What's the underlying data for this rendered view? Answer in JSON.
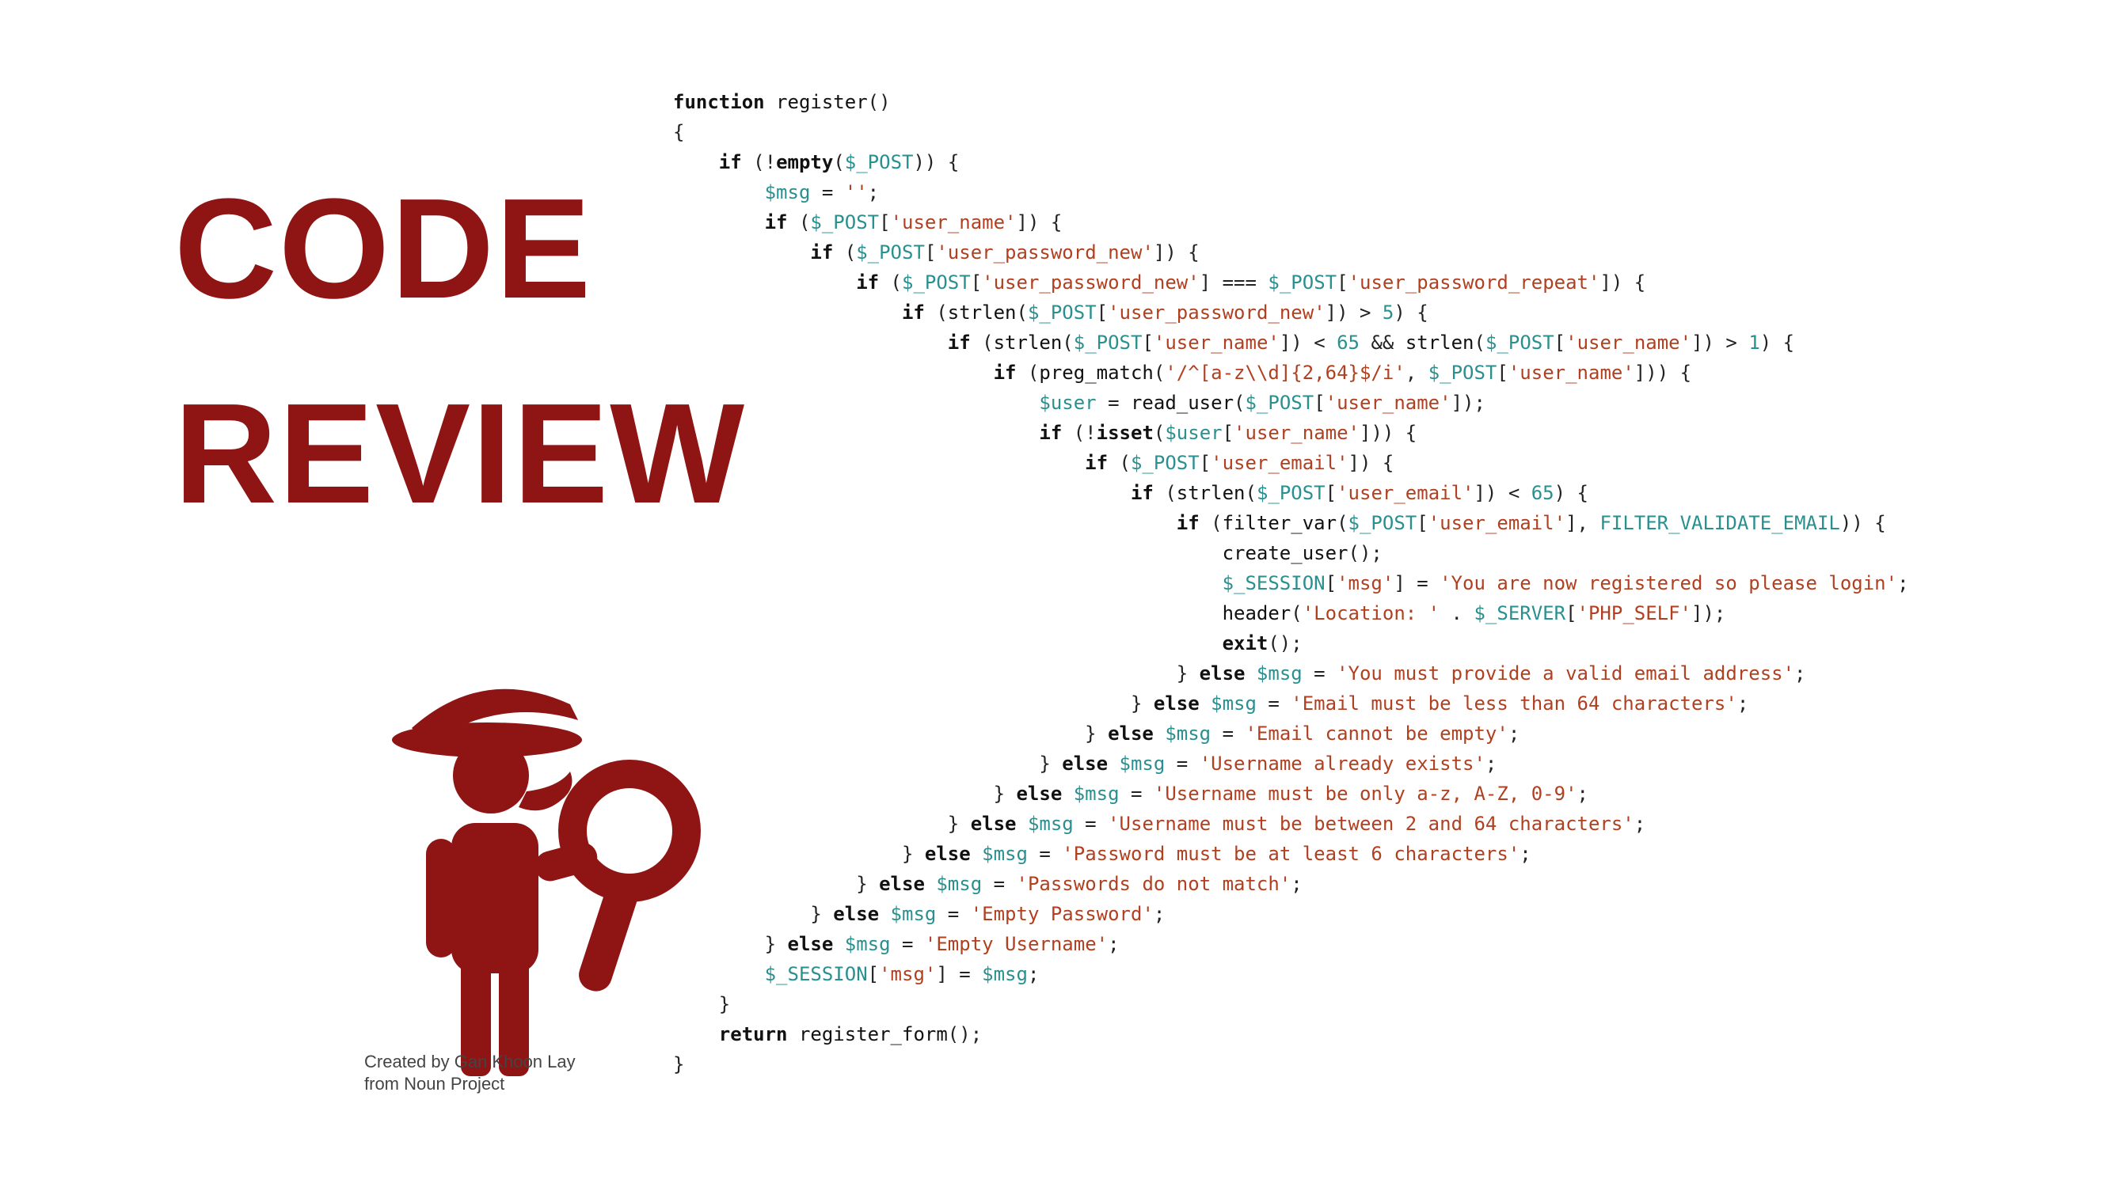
{
  "title": {
    "line1": "CODE",
    "line2": "REVIEW"
  },
  "attribution": {
    "line1": "Created by Gan Khoon Lay",
    "line2": "from Noun Project"
  },
  "colors": {
    "accent": "#8f1515",
    "keyword": "#111111",
    "variable": "#2a8f8f",
    "string": "#b04020",
    "background": "#ffffff"
  },
  "code": {
    "language": "php",
    "lines": [
      {
        "indent": 0,
        "tokens": [
          {
            "t": "k",
            "v": "function"
          },
          {
            "t": "p",
            "v": " "
          },
          {
            "t": "fn",
            "v": "register"
          },
          {
            "t": "p",
            "v": "()"
          }
        ]
      },
      {
        "indent": 0,
        "tokens": [
          {
            "t": "p",
            "v": "{"
          }
        ]
      },
      {
        "indent": 1,
        "tokens": [
          {
            "t": "k",
            "v": "if"
          },
          {
            "t": "p",
            "v": " (!"
          },
          {
            "t": "k",
            "v": "empty"
          },
          {
            "t": "p",
            "v": "("
          },
          {
            "t": "v",
            "v": "$_POST"
          },
          {
            "t": "p",
            "v": ")) {"
          }
        ]
      },
      {
        "indent": 2,
        "tokens": [
          {
            "t": "v",
            "v": "$msg"
          },
          {
            "t": "p",
            "v": " = "
          },
          {
            "t": "s",
            "v": "''"
          },
          {
            "t": "p",
            "v": ";"
          }
        ]
      },
      {
        "indent": 2,
        "tokens": [
          {
            "t": "k",
            "v": "if"
          },
          {
            "t": "p",
            "v": " ("
          },
          {
            "t": "v",
            "v": "$_POST"
          },
          {
            "t": "p",
            "v": "["
          },
          {
            "t": "s",
            "v": "'user_name'"
          },
          {
            "t": "p",
            "v": "]) {"
          }
        ]
      },
      {
        "indent": 3,
        "tokens": [
          {
            "t": "k",
            "v": "if"
          },
          {
            "t": "p",
            "v": " ("
          },
          {
            "t": "v",
            "v": "$_POST"
          },
          {
            "t": "p",
            "v": "["
          },
          {
            "t": "s",
            "v": "'user_password_new'"
          },
          {
            "t": "p",
            "v": "]) {"
          }
        ]
      },
      {
        "indent": 4,
        "tokens": [
          {
            "t": "k",
            "v": "if"
          },
          {
            "t": "p",
            "v": " ("
          },
          {
            "t": "v",
            "v": "$_POST"
          },
          {
            "t": "p",
            "v": "["
          },
          {
            "t": "s",
            "v": "'user_password_new'"
          },
          {
            "t": "p",
            "v": "] === "
          },
          {
            "t": "v",
            "v": "$_POST"
          },
          {
            "t": "p",
            "v": "["
          },
          {
            "t": "s",
            "v": "'user_password_repeat'"
          },
          {
            "t": "p",
            "v": "]) {"
          }
        ]
      },
      {
        "indent": 5,
        "tokens": [
          {
            "t": "k",
            "v": "if"
          },
          {
            "t": "p",
            "v": " ("
          },
          {
            "t": "fn",
            "v": "strlen"
          },
          {
            "t": "p",
            "v": "("
          },
          {
            "t": "v",
            "v": "$_POST"
          },
          {
            "t": "p",
            "v": "["
          },
          {
            "t": "s",
            "v": "'user_password_new'"
          },
          {
            "t": "p",
            "v": "]) > "
          },
          {
            "t": "n",
            "v": "5"
          },
          {
            "t": "p",
            "v": ") {"
          }
        ]
      },
      {
        "indent": 6,
        "tokens": [
          {
            "t": "k",
            "v": "if"
          },
          {
            "t": "p",
            "v": " ("
          },
          {
            "t": "fn",
            "v": "strlen"
          },
          {
            "t": "p",
            "v": "("
          },
          {
            "t": "v",
            "v": "$_POST"
          },
          {
            "t": "p",
            "v": "["
          },
          {
            "t": "s",
            "v": "'user_name'"
          },
          {
            "t": "p",
            "v": "]) < "
          },
          {
            "t": "n",
            "v": "65"
          },
          {
            "t": "p",
            "v": " && "
          },
          {
            "t": "fn",
            "v": "strlen"
          },
          {
            "t": "p",
            "v": "("
          },
          {
            "t": "v",
            "v": "$_POST"
          },
          {
            "t": "p",
            "v": "["
          },
          {
            "t": "s",
            "v": "'user_name'"
          },
          {
            "t": "p",
            "v": "]) > "
          },
          {
            "t": "n",
            "v": "1"
          },
          {
            "t": "p",
            "v": ") {"
          }
        ]
      },
      {
        "indent": 7,
        "tokens": [
          {
            "t": "k",
            "v": "if"
          },
          {
            "t": "p",
            "v": " ("
          },
          {
            "t": "fn",
            "v": "preg_match"
          },
          {
            "t": "p",
            "v": "("
          },
          {
            "t": "s",
            "v": "'/^[a-z\\\\d]{2,64}$/i'"
          },
          {
            "t": "p",
            "v": ", "
          },
          {
            "t": "v",
            "v": "$_POST"
          },
          {
            "t": "p",
            "v": "["
          },
          {
            "t": "s",
            "v": "'user_name'"
          },
          {
            "t": "p",
            "v": "])) {"
          }
        ]
      },
      {
        "indent": 8,
        "tokens": [
          {
            "t": "v",
            "v": "$user"
          },
          {
            "t": "p",
            "v": " = "
          },
          {
            "t": "fn",
            "v": "read_user"
          },
          {
            "t": "p",
            "v": "("
          },
          {
            "t": "v",
            "v": "$_POST"
          },
          {
            "t": "p",
            "v": "["
          },
          {
            "t": "s",
            "v": "'user_name'"
          },
          {
            "t": "p",
            "v": "]);"
          }
        ]
      },
      {
        "indent": 8,
        "tokens": [
          {
            "t": "k",
            "v": "if"
          },
          {
            "t": "p",
            "v": " (!"
          },
          {
            "t": "k",
            "v": "isset"
          },
          {
            "t": "p",
            "v": "("
          },
          {
            "t": "v",
            "v": "$user"
          },
          {
            "t": "p",
            "v": "["
          },
          {
            "t": "s",
            "v": "'user_name'"
          },
          {
            "t": "p",
            "v": "])) {"
          }
        ]
      },
      {
        "indent": 9,
        "tokens": [
          {
            "t": "k",
            "v": "if"
          },
          {
            "t": "p",
            "v": " ("
          },
          {
            "t": "v",
            "v": "$_POST"
          },
          {
            "t": "p",
            "v": "["
          },
          {
            "t": "s",
            "v": "'user_email'"
          },
          {
            "t": "p",
            "v": "]) {"
          }
        ]
      },
      {
        "indent": 10,
        "tokens": [
          {
            "t": "k",
            "v": "if"
          },
          {
            "t": "p",
            "v": " ("
          },
          {
            "t": "fn",
            "v": "strlen"
          },
          {
            "t": "p",
            "v": "("
          },
          {
            "t": "v",
            "v": "$_POST"
          },
          {
            "t": "p",
            "v": "["
          },
          {
            "t": "s",
            "v": "'user_email'"
          },
          {
            "t": "p",
            "v": "]) < "
          },
          {
            "t": "n",
            "v": "65"
          },
          {
            "t": "p",
            "v": ") {"
          }
        ]
      },
      {
        "indent": 11,
        "tokens": [
          {
            "t": "k",
            "v": "if"
          },
          {
            "t": "p",
            "v": " ("
          },
          {
            "t": "fn",
            "v": "filter_var"
          },
          {
            "t": "p",
            "v": "("
          },
          {
            "t": "v",
            "v": "$_POST"
          },
          {
            "t": "p",
            "v": "["
          },
          {
            "t": "s",
            "v": "'user_email'"
          },
          {
            "t": "p",
            "v": "], "
          },
          {
            "t": "v",
            "v": "FILTER_VALIDATE_EMAIL"
          },
          {
            "t": "p",
            "v": ")) {"
          }
        ]
      },
      {
        "indent": 12,
        "tokens": [
          {
            "t": "fn",
            "v": "create_user"
          },
          {
            "t": "p",
            "v": "();"
          }
        ]
      },
      {
        "indent": 12,
        "tokens": [
          {
            "t": "v",
            "v": "$_SESSION"
          },
          {
            "t": "p",
            "v": "["
          },
          {
            "t": "s",
            "v": "'msg'"
          },
          {
            "t": "p",
            "v": "] = "
          },
          {
            "t": "s",
            "v": "'You are now registered so please login'"
          },
          {
            "t": "p",
            "v": ";"
          }
        ]
      },
      {
        "indent": 12,
        "tokens": [
          {
            "t": "fn",
            "v": "header"
          },
          {
            "t": "p",
            "v": "("
          },
          {
            "t": "s",
            "v": "'Location: '"
          },
          {
            "t": "p",
            "v": " . "
          },
          {
            "t": "v",
            "v": "$_SERVER"
          },
          {
            "t": "p",
            "v": "["
          },
          {
            "t": "s",
            "v": "'PHP_SELF'"
          },
          {
            "t": "p",
            "v": "]);"
          }
        ]
      },
      {
        "indent": 12,
        "tokens": [
          {
            "t": "k",
            "v": "exit"
          },
          {
            "t": "p",
            "v": "();"
          }
        ]
      },
      {
        "indent": 11,
        "tokens": [
          {
            "t": "p",
            "v": "} "
          },
          {
            "t": "k",
            "v": "else"
          },
          {
            "t": "p",
            "v": " "
          },
          {
            "t": "v",
            "v": "$msg"
          },
          {
            "t": "p",
            "v": " = "
          },
          {
            "t": "s",
            "v": "'You must provide a valid email address'"
          },
          {
            "t": "p",
            "v": ";"
          }
        ]
      },
      {
        "indent": 10,
        "tokens": [
          {
            "t": "p",
            "v": "} "
          },
          {
            "t": "k",
            "v": "else"
          },
          {
            "t": "p",
            "v": " "
          },
          {
            "t": "v",
            "v": "$msg"
          },
          {
            "t": "p",
            "v": " = "
          },
          {
            "t": "s",
            "v": "'Email must be less than 64 characters'"
          },
          {
            "t": "p",
            "v": ";"
          }
        ]
      },
      {
        "indent": 9,
        "tokens": [
          {
            "t": "p",
            "v": "} "
          },
          {
            "t": "k",
            "v": "else"
          },
          {
            "t": "p",
            "v": " "
          },
          {
            "t": "v",
            "v": "$msg"
          },
          {
            "t": "p",
            "v": " = "
          },
          {
            "t": "s",
            "v": "'Email cannot be empty'"
          },
          {
            "t": "p",
            "v": ";"
          }
        ]
      },
      {
        "indent": 8,
        "tokens": [
          {
            "t": "p",
            "v": "} "
          },
          {
            "t": "k",
            "v": "else"
          },
          {
            "t": "p",
            "v": " "
          },
          {
            "t": "v",
            "v": "$msg"
          },
          {
            "t": "p",
            "v": " = "
          },
          {
            "t": "s",
            "v": "'Username already exists'"
          },
          {
            "t": "p",
            "v": ";"
          }
        ]
      },
      {
        "indent": 7,
        "tokens": [
          {
            "t": "p",
            "v": "} "
          },
          {
            "t": "k",
            "v": "else"
          },
          {
            "t": "p",
            "v": " "
          },
          {
            "t": "v",
            "v": "$msg"
          },
          {
            "t": "p",
            "v": " = "
          },
          {
            "t": "s",
            "v": "'Username must be only a-z, A-Z, 0-9'"
          },
          {
            "t": "p",
            "v": ";"
          }
        ]
      },
      {
        "indent": 6,
        "tokens": [
          {
            "t": "p",
            "v": "} "
          },
          {
            "t": "k",
            "v": "else"
          },
          {
            "t": "p",
            "v": " "
          },
          {
            "t": "v",
            "v": "$msg"
          },
          {
            "t": "p",
            "v": " = "
          },
          {
            "t": "s",
            "v": "'Username must be between 2 and 64 characters'"
          },
          {
            "t": "p",
            "v": ";"
          }
        ]
      },
      {
        "indent": 5,
        "tokens": [
          {
            "t": "p",
            "v": "} "
          },
          {
            "t": "k",
            "v": "else"
          },
          {
            "t": "p",
            "v": " "
          },
          {
            "t": "v",
            "v": "$msg"
          },
          {
            "t": "p",
            "v": " = "
          },
          {
            "t": "s",
            "v": "'Password must be at least 6 characters'"
          },
          {
            "t": "p",
            "v": ";"
          }
        ]
      },
      {
        "indent": 4,
        "tokens": [
          {
            "t": "p",
            "v": "} "
          },
          {
            "t": "k",
            "v": "else"
          },
          {
            "t": "p",
            "v": " "
          },
          {
            "t": "v",
            "v": "$msg"
          },
          {
            "t": "p",
            "v": " = "
          },
          {
            "t": "s",
            "v": "'Passwords do not match'"
          },
          {
            "t": "p",
            "v": ";"
          }
        ]
      },
      {
        "indent": 3,
        "tokens": [
          {
            "t": "p",
            "v": "} "
          },
          {
            "t": "k",
            "v": "else"
          },
          {
            "t": "p",
            "v": " "
          },
          {
            "t": "v",
            "v": "$msg"
          },
          {
            "t": "p",
            "v": " = "
          },
          {
            "t": "s",
            "v": "'Empty Password'"
          },
          {
            "t": "p",
            "v": ";"
          }
        ]
      },
      {
        "indent": 2,
        "tokens": [
          {
            "t": "p",
            "v": "} "
          },
          {
            "t": "k",
            "v": "else"
          },
          {
            "t": "p",
            "v": " "
          },
          {
            "t": "v",
            "v": "$msg"
          },
          {
            "t": "p",
            "v": " = "
          },
          {
            "t": "s",
            "v": "'Empty Username'"
          },
          {
            "t": "p",
            "v": ";"
          }
        ]
      },
      {
        "indent": 2,
        "tokens": [
          {
            "t": "v",
            "v": "$_SESSION"
          },
          {
            "t": "p",
            "v": "["
          },
          {
            "t": "s",
            "v": "'msg'"
          },
          {
            "t": "p",
            "v": "] = "
          },
          {
            "t": "v",
            "v": "$msg"
          },
          {
            "t": "p",
            "v": ";"
          }
        ]
      },
      {
        "indent": 1,
        "tokens": [
          {
            "t": "p",
            "v": "}"
          }
        ]
      },
      {
        "indent": 1,
        "tokens": [
          {
            "t": "k",
            "v": "return"
          },
          {
            "t": "p",
            "v": " "
          },
          {
            "t": "fn",
            "v": "register_form"
          },
          {
            "t": "p",
            "v": "();"
          }
        ]
      },
      {
        "indent": 0,
        "tokens": [
          {
            "t": "p",
            "v": "}"
          }
        ]
      }
    ]
  }
}
